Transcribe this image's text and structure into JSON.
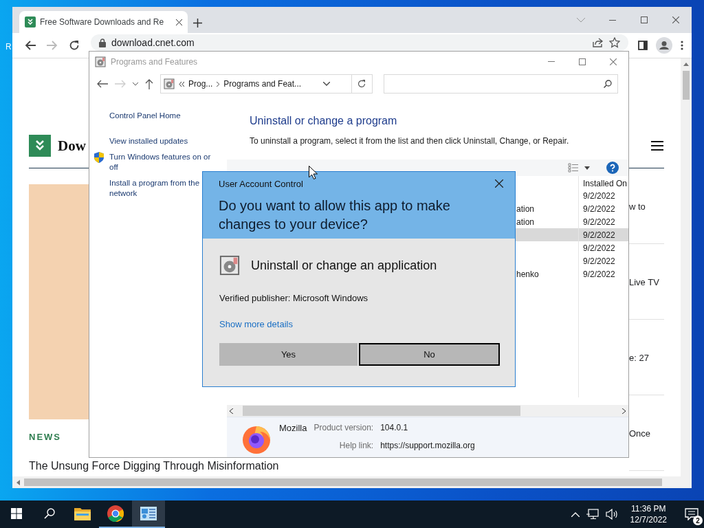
{
  "desktop": {
    "labels": [
      "R"
    ]
  },
  "browser": {
    "tab_title": "Free Software Downloads and Re",
    "url": "download.cnet.com",
    "page": {
      "logo_text": "Dow",
      "section_label": "NEWS",
      "headline": "The Unsung Force Digging Through Misinformation",
      "side_snippets": [
        "w to",
        "Live TV",
        "e: 27",
        "Once"
      ]
    }
  },
  "control_panel": {
    "title": "Programs and Features",
    "breadcrumb": [
      "Prog...",
      "Programs and Feat..."
    ],
    "sidebar": {
      "items": [
        {
          "label": "Control Panel Home",
          "kind": "link"
        },
        {
          "label": "View installed updates",
          "kind": "link"
        },
        {
          "label": "Turn Windows features on or off",
          "kind": "shield-link"
        },
        {
          "label": "Install a program from the network",
          "kind": "link"
        }
      ]
    },
    "heading": "Uninstall or change a program",
    "description": "To uninstall a program, select it from the list and then click Uninstall, Change, or Repair.",
    "list": {
      "column_header": "Installed On",
      "rows": [
        {
          "installed_on": "9/2/2022",
          "selected": false
        },
        {
          "name": "ation",
          "installed_on": "9/2/2022",
          "selected": false
        },
        {
          "name": "ation",
          "installed_on": "9/2/2022",
          "selected": false
        },
        {
          "installed_on": "9/2/2022",
          "selected": true
        },
        {
          "installed_on": "9/2/2022",
          "selected": false
        },
        {
          "installed_on": "9/2/2022",
          "selected": false
        },
        {
          "name": "henko",
          "installed_on": "9/2/2022",
          "selected": false
        }
      ]
    },
    "details": {
      "name": "Mozilla",
      "fields": [
        {
          "label": "Product version:",
          "value": "104.0.1"
        },
        {
          "label": "Help link:",
          "value": "https://support.mozilla.org"
        }
      ]
    }
  },
  "uac_dialog": {
    "title": "User Account Control",
    "question": "Do you want to allow this app to make changes to your device?",
    "program": "Uninstall or change an application",
    "publisher": "Verified publisher: Microsoft Windows",
    "details_link": "Show more details",
    "buttons": [
      {
        "label": "Yes",
        "focused": false
      },
      {
        "label": "No",
        "focused": true
      }
    ]
  },
  "taskbar": {
    "apps": [
      {
        "kind": "folder",
        "running": false,
        "selected": false
      },
      {
        "kind": "chrome",
        "running": true,
        "selected": false
      },
      {
        "kind": "control-panel",
        "running": true,
        "selected": true
      }
    ],
    "time": "11:36 PM",
    "date": "12/7/2022",
    "notification_count": "2"
  }
}
